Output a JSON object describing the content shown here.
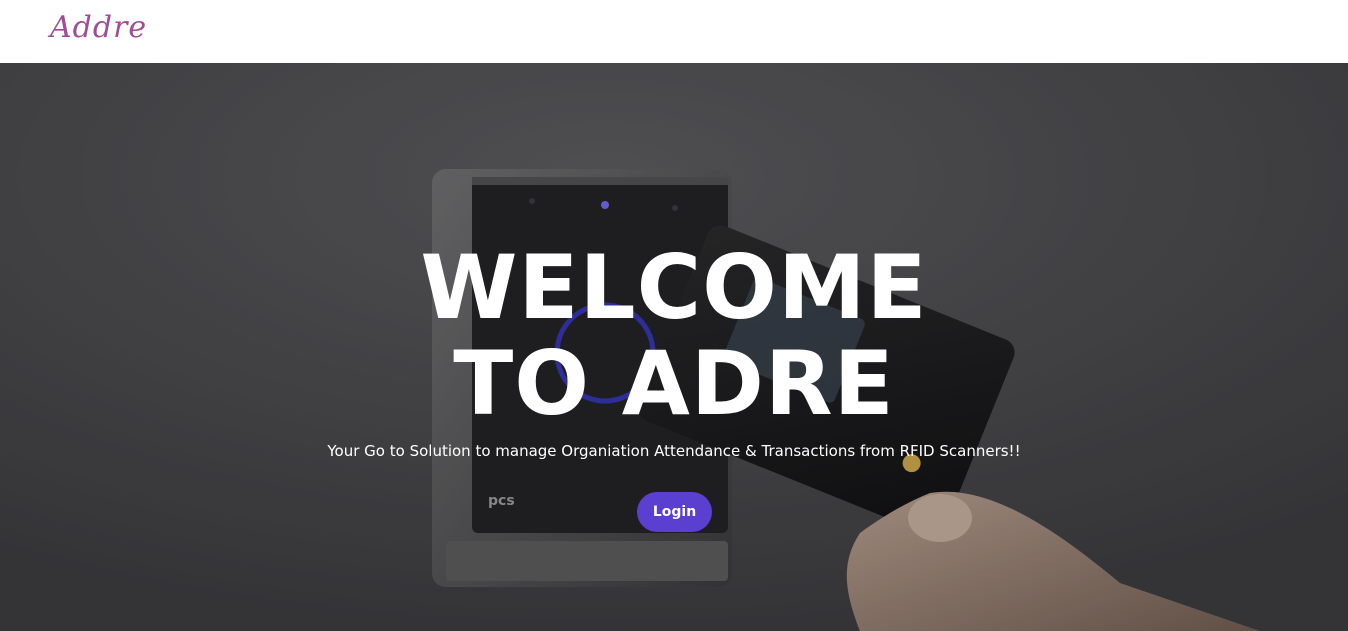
{
  "navbar": {
    "brand": "Addre",
    "brand_color": "#a04c98"
  },
  "hero": {
    "headline_line1": "WELCOME",
    "headline_line2": "TO ADRE",
    "tagline": "Your Go to Solution to manage Organiation Attendance & Transactions from RFID Scanners!!",
    "login_label": "Login",
    "background_image": "hand-holding-rfid-card-at-wall-mounted-scanner",
    "accent_color": "#5a3fd0"
  }
}
